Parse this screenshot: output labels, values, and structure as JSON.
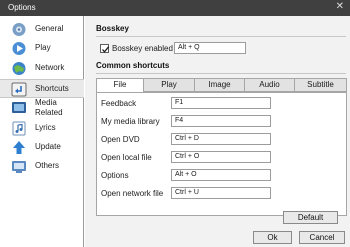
{
  "window": {
    "title": "Options",
    "close_glyph": "✕"
  },
  "sidebar": {
    "items": [
      {
        "label": "General",
        "icon": "gear-icon"
      },
      {
        "label": "Play",
        "icon": "play-icon"
      },
      {
        "label": "Network",
        "icon": "globe-icon"
      },
      {
        "label": "Shortcuts",
        "icon": "shortcut-icon",
        "selected": true
      },
      {
        "label": "Media",
        "label2": "Related",
        "icon": "media-icon"
      },
      {
        "label": "Lyrics",
        "icon": "lyrics-icon"
      },
      {
        "label": "Update",
        "icon": "update-icon"
      },
      {
        "label": "Others",
        "icon": "others-icon"
      }
    ]
  },
  "bosskey": {
    "heading": "Bosskey",
    "checkbox_label": "Bosskey enabled",
    "checked": true,
    "value": "Alt + Q"
  },
  "shortcuts": {
    "heading": "Common shortcuts",
    "tabs": [
      "File",
      "Play",
      "Image",
      "Audio",
      "Subtitle"
    ],
    "active_tab": "File",
    "rows": [
      {
        "label": "Feedback",
        "value": "F1"
      },
      {
        "label": "My media library",
        "value": "F4"
      },
      {
        "label": "Open DVD",
        "value": "Ctrl + D"
      },
      {
        "label": "Open local file",
        "value": "Ctrl + O"
      },
      {
        "label": "Options",
        "value": "Alt + O"
      },
      {
        "label": "Open network file",
        "value": "Ctrl + U"
      }
    ]
  },
  "buttons": {
    "default": "Default",
    "ok": "Ok",
    "cancel": "Cancel"
  }
}
